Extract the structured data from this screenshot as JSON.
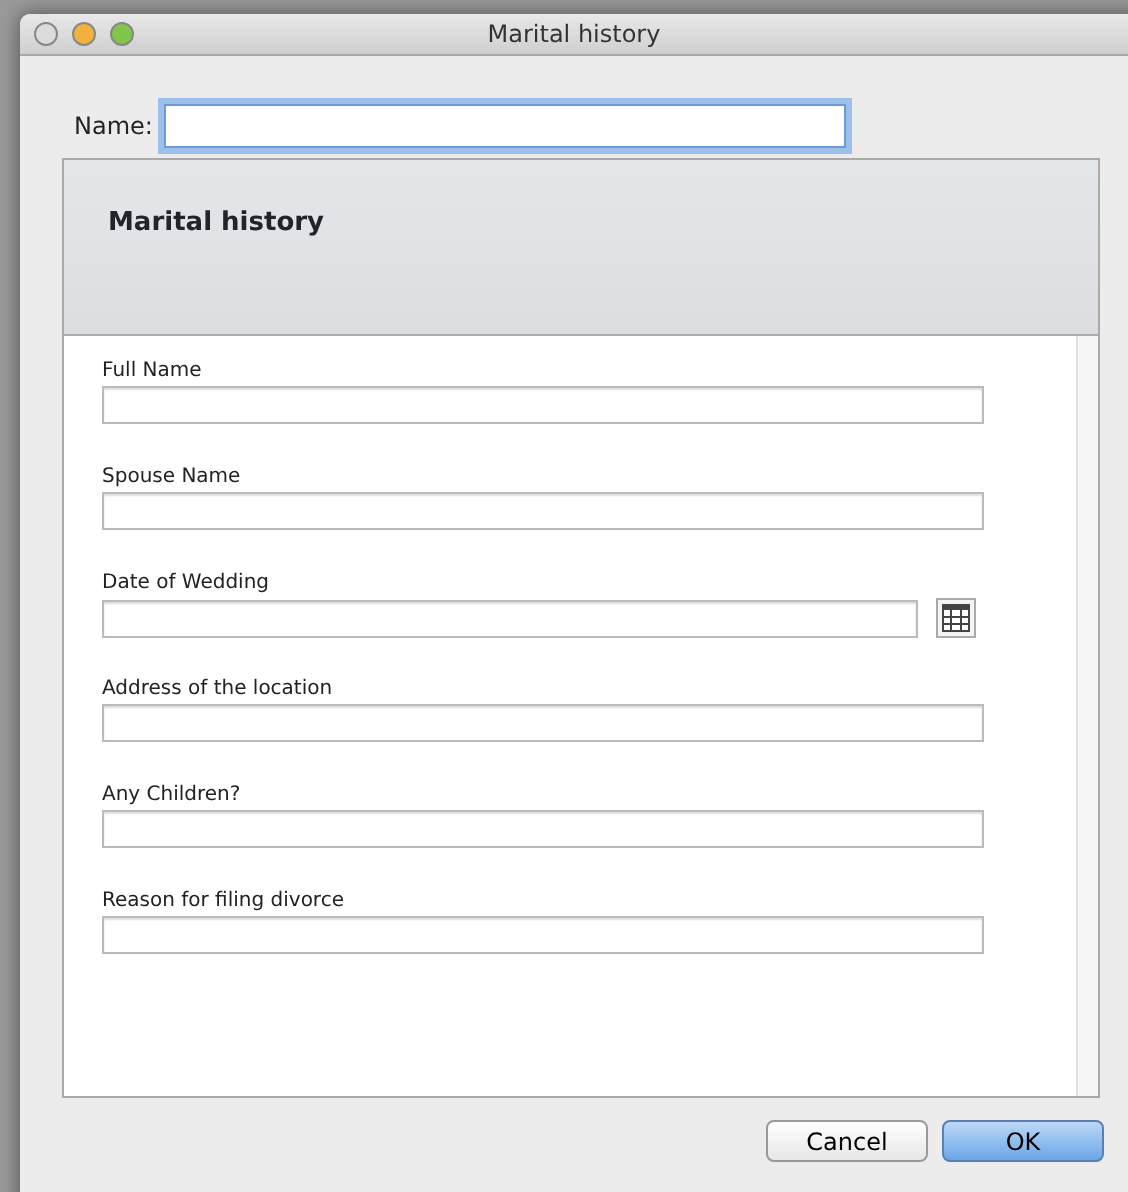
{
  "window": {
    "title": "Marital history"
  },
  "name_field": {
    "label": "Name:",
    "focused": true
  },
  "form": {
    "heading": "Marital history",
    "fields": [
      {
        "label": "Full Name",
        "kind": "text"
      },
      {
        "label": "Spouse Name",
        "kind": "text"
      },
      {
        "label": "Date of Wedding",
        "kind": "date"
      },
      {
        "label": "Address of the location",
        "kind": "text"
      },
      {
        "label": "Any Children?",
        "kind": "text"
      },
      {
        "label": "Reason for filing divorce",
        "kind": "text"
      }
    ]
  },
  "buttons": [
    {
      "label": "Cancel",
      "kind": "default"
    },
    {
      "label": "OK",
      "kind": "primary"
    }
  ]
}
